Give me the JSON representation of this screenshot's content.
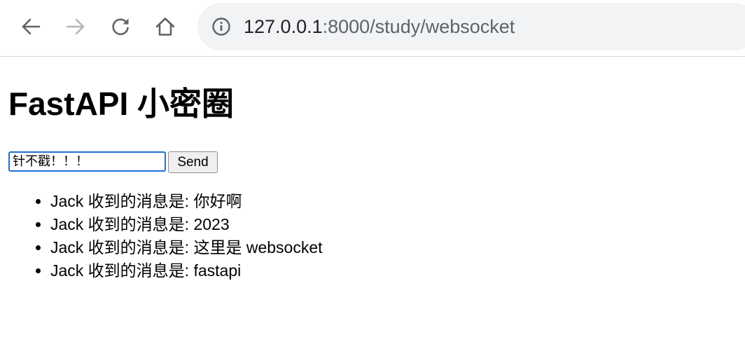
{
  "browser": {
    "back_icon": "arrow-left-icon",
    "forward_icon": "arrow-right-icon",
    "reload_icon": "reload-icon",
    "home_icon": "home-icon",
    "site_info_icon": "info-circle-icon",
    "address": {
      "host": "127.0.0.1",
      "rest": ":8000/study/websocket"
    }
  },
  "page": {
    "title": "FastAPI 小密圈",
    "message_input": {
      "value": "针不戳！！！"
    },
    "send_label": "Send",
    "messages": [
      "Jack 收到的消息是: 你好啊",
      "Jack 收到的消息是: 2023",
      "Jack 收到的消息是: 这里是 websocket",
      "Jack 收到的消息是: fastapi"
    ]
  }
}
